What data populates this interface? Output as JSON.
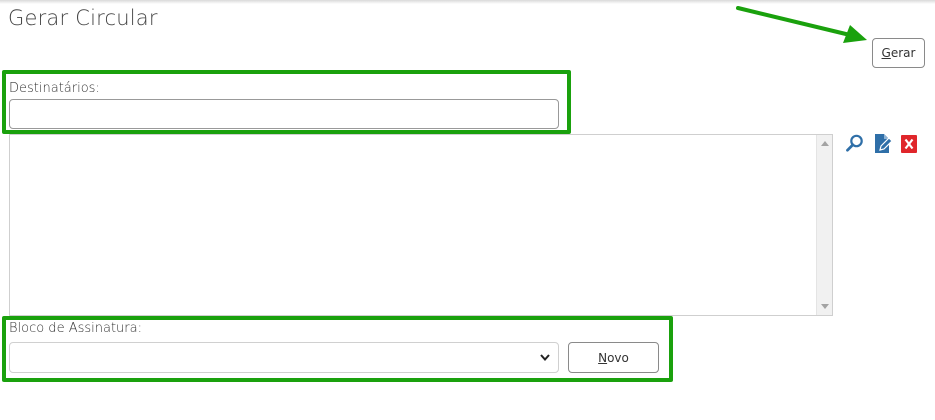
{
  "page": {
    "title": "Gerar Circular"
  },
  "toolbar": {
    "generate_label_prefix": "G",
    "generate_label_rest": "erar"
  },
  "recipients": {
    "label": "Destinatários:",
    "input_value": "",
    "icons": [
      "search-icon",
      "edit-icon",
      "remove-icon"
    ]
  },
  "signature_block": {
    "label": "Bloco de Assinatura:",
    "selected_value": "",
    "new_label_prefix": "N",
    "new_label_rest": "ovo"
  },
  "annotations": {
    "color": "#1aa10d"
  },
  "colors": {
    "search_icon": "#2f6fa8",
    "edit_icon": "#2f6fa8",
    "remove_icon": "#e0262b"
  }
}
